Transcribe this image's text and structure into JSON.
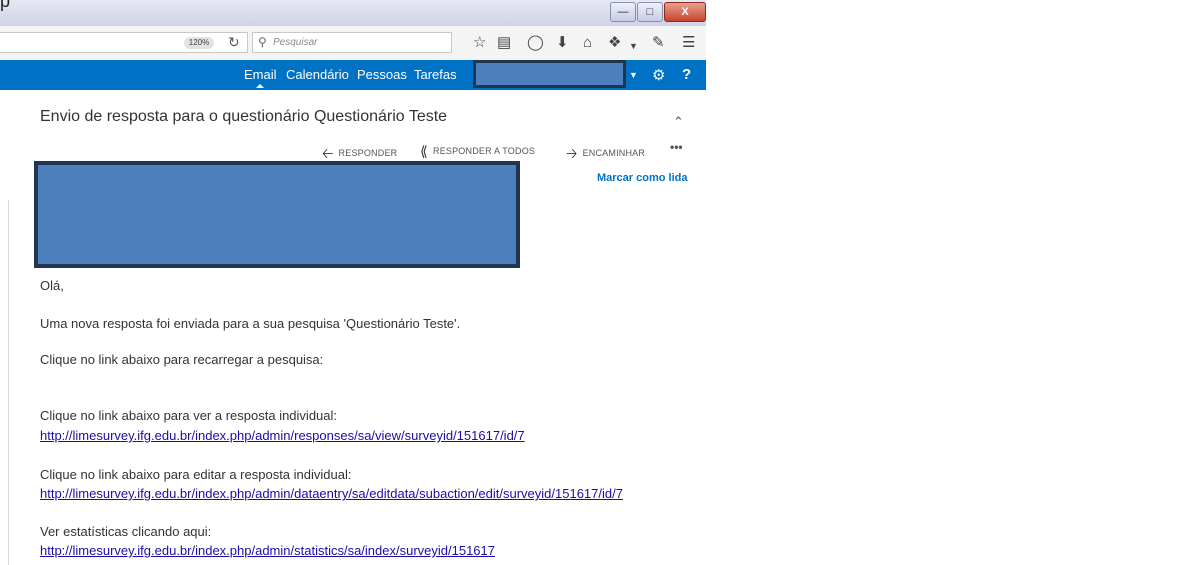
{
  "browser": {
    "zoom": "120%",
    "search_placeholder": "Pesquisar"
  },
  "app_tabs": [
    "Email",
    "Calendário",
    "Pessoas",
    "Tarefas"
  ],
  "message": {
    "subject": "Envio de resposta para o questionário Questionário Teste",
    "actions": {
      "reply": "RESPONDER",
      "reply_all": "RESPONDER A TODOS",
      "forward": "ENCAMINHAR"
    },
    "mark_read": "Marcar como lida",
    "greeting": "Olá,",
    "line1": "Uma nova resposta foi enviada para a sua pesquisa 'Questionário Teste'.",
    "line2": "Clique no link abaixo para recarregar a pesquisa:",
    "line3": "Clique no link abaixo para ver a resposta individual:",
    "link1": "http://limesurvey.ifg.edu.br/index.php/admin/responses/sa/view/surveyid/151617/id/7",
    "line4": "Clique no link abaixo para editar a resposta individual:",
    "link2": "http://limesurvey.ifg.edu.br/index.php/admin/dataentry/sa/editdata/subaction/edit/surveyid/151617/id/7",
    "line5": "Ver estatísticas clicando aqui:",
    "link3": "http://limesurvey.ifg.edu.br/index.php/admin/statistics/sa/index/surveyid/151617"
  },
  "colors": {
    "appbar": "#0072c6",
    "redaction": "#4e80bd",
    "link": "#1a0dab"
  }
}
